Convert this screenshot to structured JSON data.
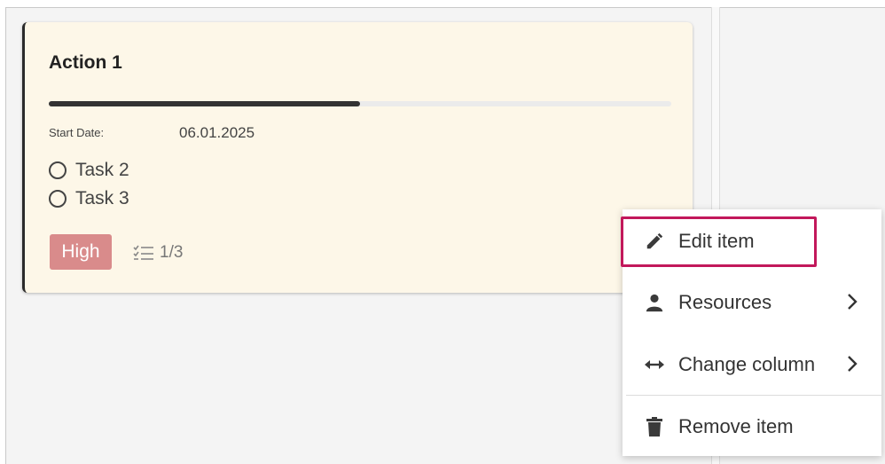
{
  "card": {
    "title": "Action 1",
    "progress_fraction": 0.5,
    "start_date_label": "Start Date:",
    "start_date_value": "06.01.2025",
    "tasks": [
      {
        "label": "Task 2",
        "done": false
      },
      {
        "label": "Task 3",
        "done": false
      }
    ],
    "priority": "High",
    "checklist_count": "1/3"
  },
  "context_menu": {
    "items": [
      {
        "label": "Edit item",
        "icon": "pencil-icon",
        "submenu": false,
        "highlighted": true
      },
      {
        "label": "Resources",
        "icon": "person-icon",
        "submenu": true
      },
      {
        "label": "Change column",
        "icon": "horizontal-arrows-icon",
        "submenu": true
      },
      {
        "label": "Remove item",
        "icon": "trash-icon",
        "submenu": false
      }
    ]
  },
  "colors": {
    "card_bg": "#fdf7e8",
    "priority_badge": "#d98b8b",
    "highlight_border": "#c2185b",
    "progress_fill": "#333333"
  }
}
